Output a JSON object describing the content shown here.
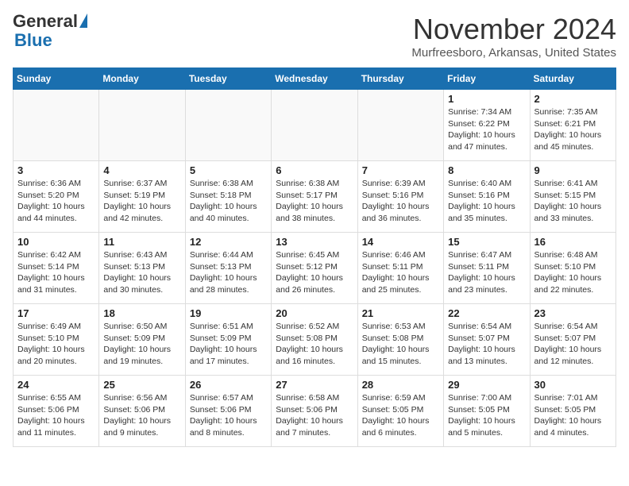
{
  "header": {
    "logo": {
      "general": "General",
      "blue": "Blue"
    },
    "title": "November 2024",
    "location": "Murfreesboro, Arkansas, United States"
  },
  "calendar": {
    "days_of_week": [
      "Sunday",
      "Monday",
      "Tuesday",
      "Wednesday",
      "Thursday",
      "Friday",
      "Saturday"
    ],
    "weeks": [
      [
        {
          "day": "",
          "info": ""
        },
        {
          "day": "",
          "info": ""
        },
        {
          "day": "",
          "info": ""
        },
        {
          "day": "",
          "info": ""
        },
        {
          "day": "",
          "info": ""
        },
        {
          "day": "1",
          "info": "Sunrise: 7:34 AM\nSunset: 6:22 PM\nDaylight: 10 hours and 47 minutes."
        },
        {
          "day": "2",
          "info": "Sunrise: 7:35 AM\nSunset: 6:21 PM\nDaylight: 10 hours and 45 minutes."
        }
      ],
      [
        {
          "day": "3",
          "info": "Sunrise: 6:36 AM\nSunset: 5:20 PM\nDaylight: 10 hours and 44 minutes."
        },
        {
          "day": "4",
          "info": "Sunrise: 6:37 AM\nSunset: 5:19 PM\nDaylight: 10 hours and 42 minutes."
        },
        {
          "day": "5",
          "info": "Sunrise: 6:38 AM\nSunset: 5:18 PM\nDaylight: 10 hours and 40 minutes."
        },
        {
          "day": "6",
          "info": "Sunrise: 6:38 AM\nSunset: 5:17 PM\nDaylight: 10 hours and 38 minutes."
        },
        {
          "day": "7",
          "info": "Sunrise: 6:39 AM\nSunset: 5:16 PM\nDaylight: 10 hours and 36 minutes."
        },
        {
          "day": "8",
          "info": "Sunrise: 6:40 AM\nSunset: 5:16 PM\nDaylight: 10 hours and 35 minutes."
        },
        {
          "day": "9",
          "info": "Sunrise: 6:41 AM\nSunset: 5:15 PM\nDaylight: 10 hours and 33 minutes."
        }
      ],
      [
        {
          "day": "10",
          "info": "Sunrise: 6:42 AM\nSunset: 5:14 PM\nDaylight: 10 hours and 31 minutes."
        },
        {
          "day": "11",
          "info": "Sunrise: 6:43 AM\nSunset: 5:13 PM\nDaylight: 10 hours and 30 minutes."
        },
        {
          "day": "12",
          "info": "Sunrise: 6:44 AM\nSunset: 5:13 PM\nDaylight: 10 hours and 28 minutes."
        },
        {
          "day": "13",
          "info": "Sunrise: 6:45 AM\nSunset: 5:12 PM\nDaylight: 10 hours and 26 minutes."
        },
        {
          "day": "14",
          "info": "Sunrise: 6:46 AM\nSunset: 5:11 PM\nDaylight: 10 hours and 25 minutes."
        },
        {
          "day": "15",
          "info": "Sunrise: 6:47 AM\nSunset: 5:11 PM\nDaylight: 10 hours and 23 minutes."
        },
        {
          "day": "16",
          "info": "Sunrise: 6:48 AM\nSunset: 5:10 PM\nDaylight: 10 hours and 22 minutes."
        }
      ],
      [
        {
          "day": "17",
          "info": "Sunrise: 6:49 AM\nSunset: 5:10 PM\nDaylight: 10 hours and 20 minutes."
        },
        {
          "day": "18",
          "info": "Sunrise: 6:50 AM\nSunset: 5:09 PM\nDaylight: 10 hours and 19 minutes."
        },
        {
          "day": "19",
          "info": "Sunrise: 6:51 AM\nSunset: 5:09 PM\nDaylight: 10 hours and 17 minutes."
        },
        {
          "day": "20",
          "info": "Sunrise: 6:52 AM\nSunset: 5:08 PM\nDaylight: 10 hours and 16 minutes."
        },
        {
          "day": "21",
          "info": "Sunrise: 6:53 AM\nSunset: 5:08 PM\nDaylight: 10 hours and 15 minutes."
        },
        {
          "day": "22",
          "info": "Sunrise: 6:54 AM\nSunset: 5:07 PM\nDaylight: 10 hours and 13 minutes."
        },
        {
          "day": "23",
          "info": "Sunrise: 6:54 AM\nSunset: 5:07 PM\nDaylight: 10 hours and 12 minutes."
        }
      ],
      [
        {
          "day": "24",
          "info": "Sunrise: 6:55 AM\nSunset: 5:06 PM\nDaylight: 10 hours and 11 minutes."
        },
        {
          "day": "25",
          "info": "Sunrise: 6:56 AM\nSunset: 5:06 PM\nDaylight: 10 hours and 9 minutes."
        },
        {
          "day": "26",
          "info": "Sunrise: 6:57 AM\nSunset: 5:06 PM\nDaylight: 10 hours and 8 minutes."
        },
        {
          "day": "27",
          "info": "Sunrise: 6:58 AM\nSunset: 5:06 PM\nDaylight: 10 hours and 7 minutes."
        },
        {
          "day": "28",
          "info": "Sunrise: 6:59 AM\nSunset: 5:05 PM\nDaylight: 10 hours and 6 minutes."
        },
        {
          "day": "29",
          "info": "Sunrise: 7:00 AM\nSunset: 5:05 PM\nDaylight: 10 hours and 5 minutes."
        },
        {
          "day": "30",
          "info": "Sunrise: 7:01 AM\nSunset: 5:05 PM\nDaylight: 10 hours and 4 minutes."
        }
      ]
    ]
  }
}
